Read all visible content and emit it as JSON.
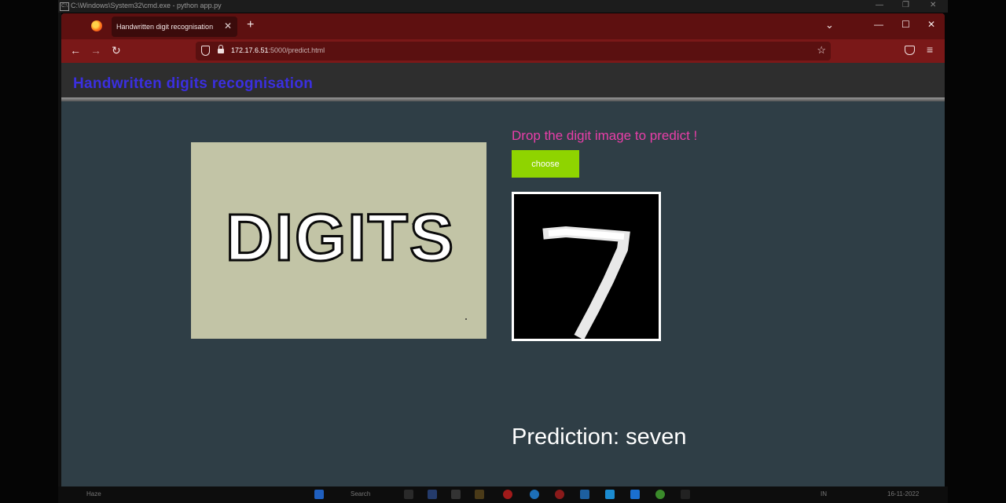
{
  "cmd": {
    "title": "C:\\Windows\\System32\\cmd.exe - python  app.py"
  },
  "browser": {
    "tab_title": "Handwritten digit recognisation",
    "url_host": "172.17.6.51",
    "url_path": ":5000/predict.html"
  },
  "page": {
    "title": "Handwritten digits recognisation",
    "banner_text": "DIGITS",
    "drop_label": "Drop the digit image to predict !",
    "choose_label": "choose",
    "prediction_text": "Prediction: seven"
  },
  "taskbar": {
    "weather": "Haze",
    "search": "Search",
    "lang": "IN",
    "date": "16-11-2022"
  },
  "colors": {
    "tab_bar": "#5e1010",
    "nav_bar": "#7a1818",
    "page_bg": "#2f3e46",
    "site_title": "#3b2fe0",
    "drop_label": "#e83ea8",
    "choose_button": "#8fd400"
  }
}
